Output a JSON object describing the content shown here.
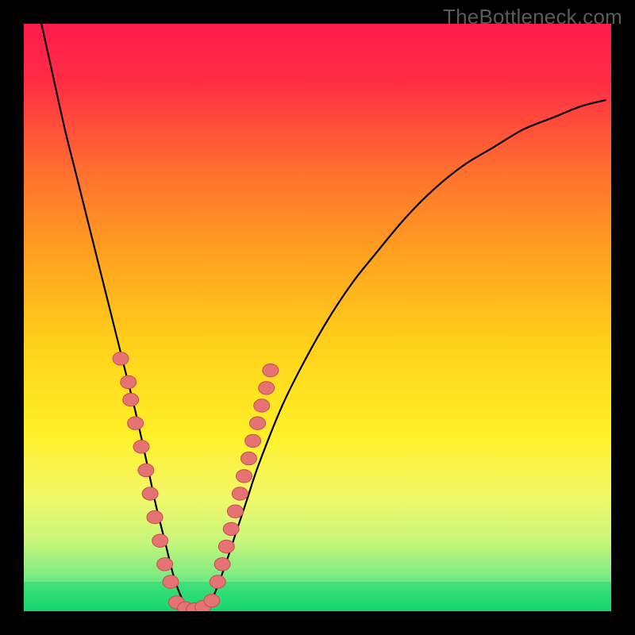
{
  "watermark": "TheBottleneck.com",
  "chart_data": {
    "type": "line",
    "title": "",
    "xlabel": "",
    "ylabel": "",
    "xlim": [
      0,
      100
    ],
    "ylim": [
      0,
      100
    ],
    "background_gradient": {
      "stops": [
        {
          "offset": 0.0,
          "color": "#ff1a4b"
        },
        {
          "offset": 0.1,
          "color": "#ff2e44"
        },
        {
          "offset": 0.25,
          "color": "#ff6f2f"
        },
        {
          "offset": 0.4,
          "color": "#ffa31f"
        },
        {
          "offset": 0.55,
          "color": "#ffd21a"
        },
        {
          "offset": 0.7,
          "color": "#fff028"
        },
        {
          "offset": 0.8,
          "color": "#f4f868"
        },
        {
          "offset": 0.88,
          "color": "#c8f67a"
        },
        {
          "offset": 0.94,
          "color": "#7eeb84"
        },
        {
          "offset": 1.0,
          "color": "#14d66e"
        }
      ]
    },
    "green_band": {
      "y_from": 95,
      "y_to": 100
    },
    "series": [
      {
        "name": "bottleneck-curve",
        "x": [
          3,
          5,
          7,
          9,
          11,
          13,
          15,
          17,
          19,
          21,
          22.5,
          24,
          25.5,
          27,
          28.5,
          30,
          32,
          34,
          36,
          38,
          40,
          44,
          48,
          52,
          56,
          60,
          65,
          70,
          75,
          80,
          85,
          90,
          95,
          99
        ],
        "y": [
          0,
          9,
          18,
          26,
          34,
          42,
          50,
          58,
          66,
          75,
          82,
          88,
          94,
          98,
          100,
          100,
          98,
          93,
          87,
          81,
          75,
          65,
          57,
          50,
          44,
          39,
          33,
          28,
          24,
          21,
          18,
          16,
          14,
          13
        ]
      }
    ],
    "marker_clusters": [
      {
        "name": "left-arm-markers",
        "points": [
          {
            "x": 16.5,
            "y": 57
          },
          {
            "x": 17.8,
            "y": 61
          },
          {
            "x": 18.2,
            "y": 64
          },
          {
            "x": 19.0,
            "y": 68
          },
          {
            "x": 20.0,
            "y": 72
          },
          {
            "x": 20.8,
            "y": 76
          },
          {
            "x": 21.5,
            "y": 80
          },
          {
            "x": 22.3,
            "y": 84
          },
          {
            "x": 23.2,
            "y": 88
          },
          {
            "x": 24.0,
            "y": 92
          },
          {
            "x": 25.0,
            "y": 95
          }
        ]
      },
      {
        "name": "bottom-markers",
        "points": [
          {
            "x": 26.0,
            "y": 98.5
          },
          {
            "x": 27.5,
            "y": 99.5
          },
          {
            "x": 29.0,
            "y": 99.7
          },
          {
            "x": 30.5,
            "y": 99.3
          },
          {
            "x": 32.0,
            "y": 98.2
          }
        ]
      },
      {
        "name": "right-arm-markers",
        "points": [
          {
            "x": 33.0,
            "y": 95
          },
          {
            "x": 33.8,
            "y": 92
          },
          {
            "x": 34.5,
            "y": 89
          },
          {
            "x": 35.3,
            "y": 86
          },
          {
            "x": 36.0,
            "y": 83
          },
          {
            "x": 36.8,
            "y": 80
          },
          {
            "x": 37.5,
            "y": 77
          },
          {
            "x": 38.3,
            "y": 74
          },
          {
            "x": 39.0,
            "y": 71
          },
          {
            "x": 39.8,
            "y": 68
          },
          {
            "x": 40.5,
            "y": 65
          },
          {
            "x": 41.3,
            "y": 62
          },
          {
            "x": 42.0,
            "y": 59
          }
        ]
      }
    ],
    "marker_style": {
      "fill": "#e57373",
      "stroke": "#c94f4f",
      "r": 10
    },
    "curve_style": {
      "stroke": "#000000",
      "width": 2.2
    }
  }
}
